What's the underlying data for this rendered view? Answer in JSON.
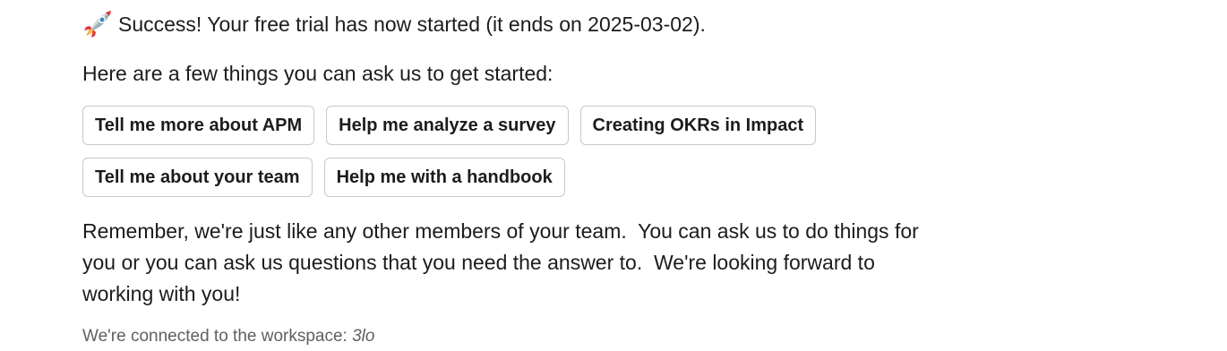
{
  "message": {
    "success_text": "Success! Your free trial has now started (it ends on 2025-03-02).",
    "intro_text": "Here are a few things you can ask us to get started:",
    "suggestions_row1": [
      "Tell me more about APM",
      "Help me analyze a survey",
      "Creating OKRs in Impact"
    ],
    "suggestions_row2": [
      "Tell me about your team",
      "Help me with a handbook"
    ],
    "reminder_lines": [
      "Remember, we're just like any other members of your team.  You can ask us to do things for",
      "you or you can ask us questions that you need the answer to.  We're looking forward to",
      "working with you!"
    ],
    "context_prefix": "We're connected to the workspace: ",
    "workspace_name": "3lo"
  },
  "icons": {
    "rocket": "rocket-icon"
  },
  "colors": {
    "text": "#1d1c1d",
    "muted_text": "#616061",
    "chip_border": "#c9c9cb"
  }
}
